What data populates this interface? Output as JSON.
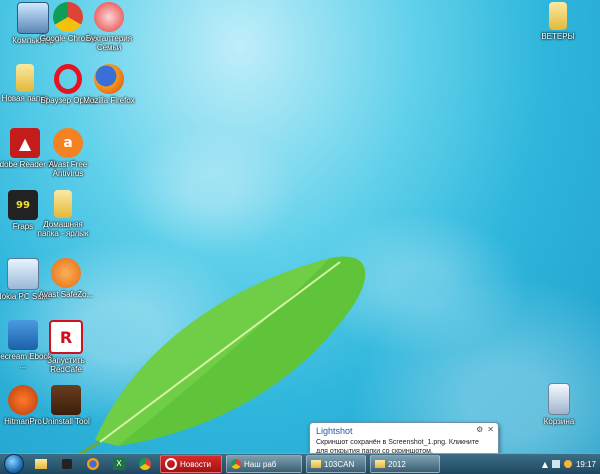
{
  "desktop": {
    "icons": [
      {
        "label": "Компьютер",
        "icon": "computer-icon"
      },
      {
        "label": "Google Chrome",
        "icon": "chrome-icon"
      },
      {
        "label": "Бухгалтерия Семьи",
        "icon": "family-accounting-icon"
      },
      {
        "label": "Новая папка",
        "icon": "folder-icon"
      },
      {
        "label": "Браузер Opera",
        "icon": "opera-icon"
      },
      {
        "label": "Mozilla Firefox",
        "icon": "firefox-icon"
      },
      {
        "label": "Adobe Reader XI",
        "icon": "adobe-reader-icon"
      },
      {
        "label": "Avast Free Antivirus",
        "icon": "avast-icon"
      },
      {
        "label": "Fraps",
        "icon": "fraps-icon"
      },
      {
        "label": "Домашняя папка - ярлык",
        "icon": "folder-shortcut-icon"
      },
      {
        "label": "Nokia PC Suite",
        "icon": "nokia-pc-suite-icon"
      },
      {
        "label": "Avast SafeZo...",
        "icon": "avast-safezone-icon"
      },
      {
        "label": "Icecream Ebook ...",
        "icon": "ebook-reader-icon"
      },
      {
        "label": "Запустить RedCafe",
        "icon": "redcafe-icon"
      },
      {
        "label": "HitmanPro",
        "icon": "hitmanpro-icon"
      },
      {
        "label": "Uninstall Tool",
        "icon": "uninstall-tool-icon"
      },
      {
        "label": "ВЕТЕРЫ",
        "icon": "folder-icon"
      },
      {
        "label": "Корзина",
        "icon": "recycle-bin-icon"
      }
    ]
  },
  "taskbar": {
    "tasks": [
      {
        "label": "Новости",
        "icon": "opera-icon"
      },
      {
        "label": "Наш раб",
        "icon": "chrome-icon"
      },
      {
        "label": "103CAN",
        "icon": "folder-icon"
      },
      {
        "label": "2012",
        "icon": "folder-icon"
      }
    ],
    "clock_time": "19:17"
  },
  "notification": {
    "title": "Lightshot",
    "body": "Скриншот сохранён в Screenshot_1.png. Кликните для открытия папки со скриншотом."
  }
}
